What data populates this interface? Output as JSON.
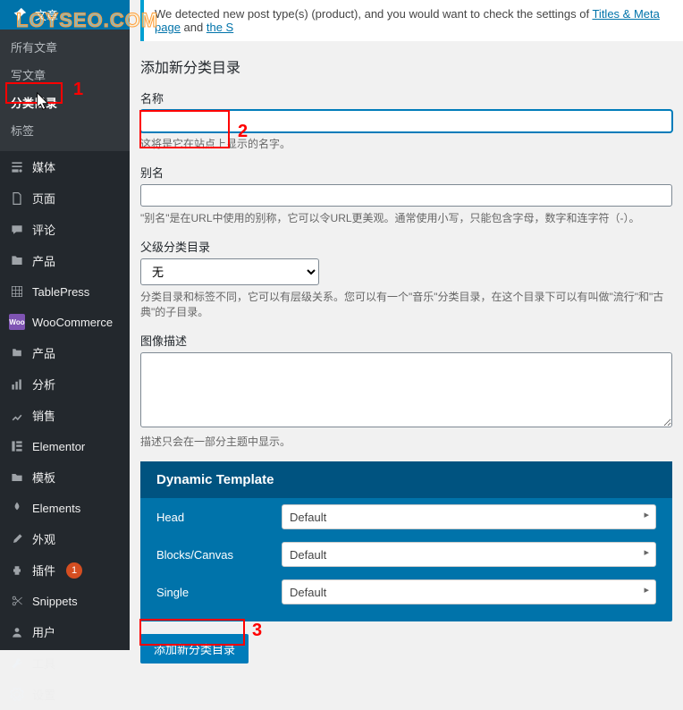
{
  "watermark": "LOYSEO.COM",
  "notice": {
    "prefix": "We detected new post type(s) (product), and you would want to check the settings of ",
    "link1": "Titles & Meta page",
    "mid": " and ",
    "link2": "the S"
  },
  "sidebar": {
    "posts": {
      "label": "文章",
      "items": [
        "所有文章",
        "写文章",
        "分类目录",
        "标签"
      ]
    },
    "items": [
      {
        "icon": "media",
        "label": "媒体"
      },
      {
        "icon": "page",
        "label": "页面"
      },
      {
        "icon": "comments",
        "label": "评论"
      },
      {
        "icon": "product",
        "label": "产品"
      },
      {
        "icon": "tablepress",
        "label": "TablePress"
      },
      {
        "icon": "woo",
        "label": "WooCommerce"
      },
      {
        "icon": "product",
        "label": "产品"
      },
      {
        "icon": "analytics",
        "label": "分析"
      },
      {
        "icon": "sales",
        "label": "销售"
      },
      {
        "icon": "elementor",
        "label": "Elementor"
      },
      {
        "icon": "templates",
        "label": "模板"
      },
      {
        "icon": "elements",
        "label": "Elements"
      },
      {
        "icon": "appearance",
        "label": "外观"
      },
      {
        "icon": "plugins",
        "label": "插件",
        "badge": "1"
      },
      {
        "icon": "snippets",
        "label": "Snippets"
      },
      {
        "icon": "users",
        "label": "用户"
      },
      {
        "icon": "tools",
        "label": "工具"
      },
      {
        "icon": "settings",
        "label": "设置"
      }
    ]
  },
  "form": {
    "heading": "添加新分类目录",
    "name": {
      "label": "名称",
      "value": "",
      "desc": "这将是它在站点上显示的名字。"
    },
    "slug": {
      "label": "别名",
      "value": "",
      "desc": "\"别名\"是在URL中使用的别称，它可以令URL更美观。通常使用小写，只能包含字母，数字和连字符（-）。"
    },
    "parent": {
      "label": "父级分类目录",
      "selected": "无",
      "desc": "分类目录和标签不同，它可以有层级关系。您可以有一个\"音乐\"分类目录，在这个目录下可以有叫做\"流行\"和\"古典\"的子目录。"
    },
    "desc": {
      "label": "图像描述",
      "value": "",
      "desc": "描述只会在一部分主题中显示。"
    }
  },
  "dynamic_template": {
    "title": "Dynamic Template",
    "rows": [
      {
        "label": "Head",
        "value": "Default"
      },
      {
        "label": "Blocks/Canvas",
        "value": "Default"
      },
      {
        "label": "Single",
        "value": "Default"
      }
    ]
  },
  "submit": {
    "label": "添加新分类目录"
  },
  "annotations": {
    "n1": "1",
    "n2": "2",
    "n3": "3"
  }
}
